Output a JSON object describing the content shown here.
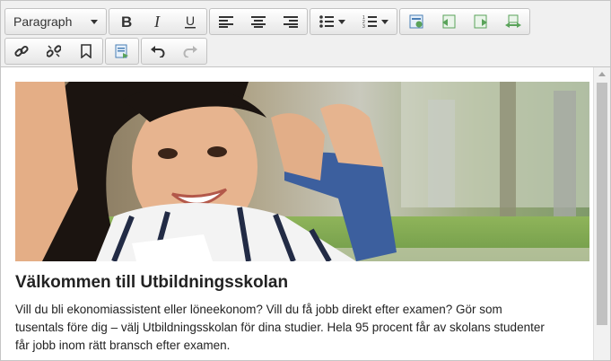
{
  "toolbar": {
    "format_value": "Paragraph",
    "row1": [
      "bold",
      "italic",
      "underline",
      "align-left",
      "align-center",
      "align-right",
      "bullet-list",
      "numbered-list",
      "insert-block",
      "insert-left",
      "insert-right",
      "swap-blocks"
    ],
    "row2": [
      "link",
      "unlink",
      "bookmark",
      "template",
      "undo",
      "redo"
    ]
  },
  "content": {
    "heading": "Välkommen till Utbildningsskolan",
    "paragraph": "Vill du bli ekonomiassistent eller löneekonom? Vill du få jobb direkt efter examen? Gör som tusentals före dig – välj Utbildningsskolan för dina studier. Hela 95 procent får av skolans studenter får jobb inom rätt bransch efter examen."
  },
  "colors": {
    "toolbar_bg": "#f0f0f0",
    "icon_green": "#5aa35a",
    "icon_blue": "#4a7fb5",
    "text": "#222222"
  }
}
